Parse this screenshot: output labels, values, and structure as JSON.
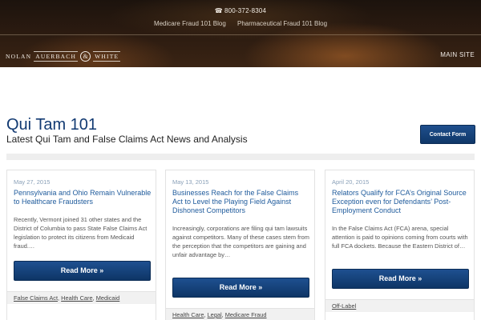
{
  "header": {
    "phone": "800-372-8304",
    "phone_icon": "☎",
    "blog_links": [
      "Medicare Fraud 101 Blog",
      "Pharmaceutical Fraud 101 Blog"
    ],
    "logo": {
      "part1": "NOLAN",
      "part2": "AUERBACH",
      "amp": "&",
      "part3": "WHITE"
    },
    "main_site": "MAIN SITE"
  },
  "page": {
    "title": "Qui Tam 101",
    "subtitle": "Latest Qui Tam and False Claims Act News and Analysis",
    "contact_button": "Contact Form"
  },
  "posts": [
    {
      "date": "May 27, 2015",
      "headline": "Pennsylvania and Ohio Remain Vulnerable to Healthcare Fraudsters",
      "excerpt": "Recently, Vermont joined 31 other states and the District of Columbia to pass State False Claims Act legislation to protect its citizens from Medicaid fraud.…",
      "read_more": "Read More »",
      "tags": [
        "False Claims Act",
        "Health Care",
        "Medicaid"
      ]
    },
    {
      "date": "May 13, 2015",
      "headline": "Businesses Reach for the False Claims Act to Level the Playing Field Against Dishonest Competitors",
      "excerpt": "Increasingly, corporations are filing qui tam lawsuits against competitors. Many of these cases stem from the perception that the competitors are gaining and unfair advantage by…",
      "read_more": "Read More »",
      "tags": [
        "Health Care",
        "Legal",
        "Medicare Fraud"
      ]
    },
    {
      "date": "April 20, 2015",
      "headline": "Relators Qualify for FCA’s Original Source Exception even for Defendants’ Post-Employment Conduct",
      "excerpt": "In the False Claims Act (FCA) arena, special attention is paid to opinions coming from courts with full FCA dockets. Because the Eastern District of…",
      "read_more": "Read More »",
      "tags": [
        "Off-Label"
      ]
    }
  ],
  "colors": {
    "brand_blue": "#123a72",
    "link_blue": "#1f5b9c",
    "button_blue": "#0f3768"
  }
}
